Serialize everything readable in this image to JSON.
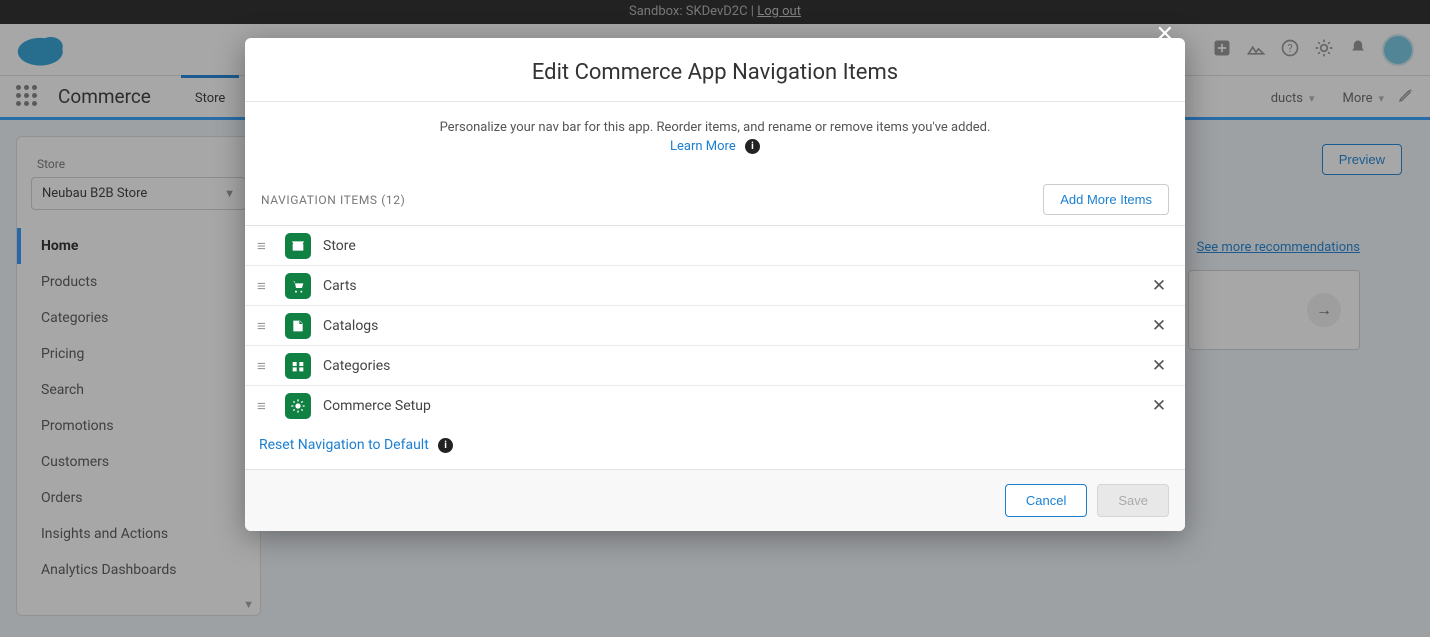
{
  "sandbox": {
    "prefix": "Sandbox:",
    "name": "SKDevD2C",
    "logout": "Log out"
  },
  "app_name": "Commerce",
  "top_tabs": [
    {
      "label": "Store",
      "active": true
    },
    {
      "label": "ducts"
    },
    {
      "label": "More"
    }
  ],
  "sidebar": {
    "label": "Store",
    "selected": "Neubau B2B Store",
    "items": [
      {
        "label": "Home",
        "active": true
      },
      {
        "label": "Products"
      },
      {
        "label": "Categories"
      },
      {
        "label": "Pricing"
      },
      {
        "label": "Search"
      },
      {
        "label": "Promotions"
      },
      {
        "label": "Customers"
      },
      {
        "label": "Orders"
      },
      {
        "label": "Insights and Actions"
      },
      {
        "label": "Analytics Dashboards"
      }
    ]
  },
  "preview_label": "Preview",
  "see_more_label": "See more recommendations",
  "modal": {
    "title": "Edit Commerce App Navigation Items",
    "subtitle": "Personalize your nav bar for this app. Reorder items, and rename or remove items you've added.",
    "learn_more": "Learn More",
    "nav_header": "NAVIGATION ITEMS (12)",
    "nav_count": 12,
    "add_more": "Add More Items",
    "items": [
      {
        "label": "Store",
        "icon": "store",
        "removable": false
      },
      {
        "label": "Carts",
        "icon": "cart",
        "removable": true
      },
      {
        "label": "Catalogs",
        "icon": "catalog",
        "removable": true
      },
      {
        "label": "Categories",
        "icon": "category",
        "removable": true
      },
      {
        "label": "Commerce Setup",
        "icon": "setup",
        "removable": true
      }
    ],
    "reset": "Reset Navigation to Default",
    "cancel": "Cancel",
    "save": "Save"
  }
}
